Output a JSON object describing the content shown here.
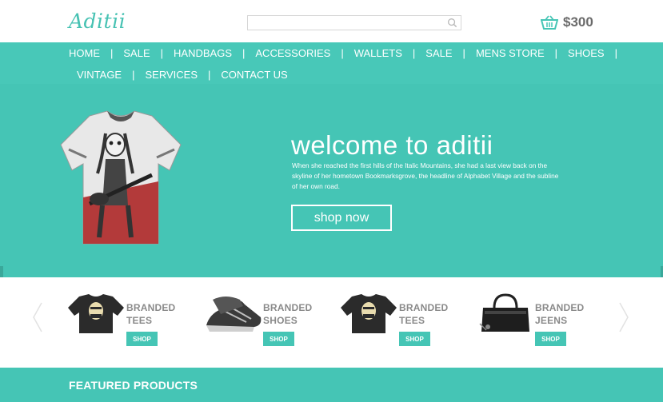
{
  "header": {
    "logo": "Aditii",
    "search_placeholder": "",
    "cart_total": "$300"
  },
  "nav": {
    "row1": [
      "HOME",
      "SALE",
      "HANDBAGS",
      "ACCESSORIES",
      "WALLETS",
      "SALE",
      "MENS STORE",
      "SHOES"
    ],
    "row2": [
      "VINTAGE",
      "SERVICES",
      "CONTACT US"
    ]
  },
  "hero": {
    "title": "welcome to aditii",
    "text": "When she reached the first hills of the Italic Mountains, she had a last view back on the skyline of her hometown Bookmarksgrove, the headline of Alphabet Village and the subline of her own road.",
    "button": "shop now"
  },
  "products": [
    {
      "line1": "BRANDED",
      "line2": "TEES",
      "shop": "SHOP",
      "icon": "tshirt-icon"
    },
    {
      "line1": "BRANDED",
      "line2": "SHOES",
      "shop": "SHOP",
      "icon": "shoe-icon"
    },
    {
      "line1": "BRANDED",
      "line2": "TEES",
      "shop": "SHOP",
      "icon": "tshirt-icon"
    },
    {
      "line1": "BRANDED",
      "line2": "JEENS",
      "shop": "SHOP",
      "icon": "handbag-icon"
    }
  ],
  "featured": {
    "title": "FEATURED PRODUCTS"
  },
  "colors": {
    "accent": "#45c5b5",
    "nav": "#48c8b8",
    "price": "#6a6a6a"
  }
}
